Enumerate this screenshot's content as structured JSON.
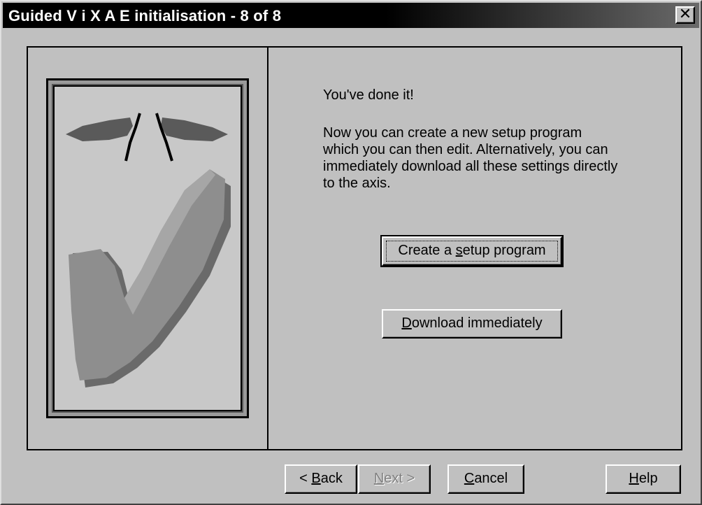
{
  "window": {
    "title": "Guided V i X A E initialisation - 8 of 8",
    "close_glyph": "✕"
  },
  "message": {
    "heading": "You've done it!",
    "body_lines": [
      "Now you can create a new setup program",
      "which you can then edit. Alternatively, you can",
      "immediately download all these settings directly",
      "to the axis."
    ]
  },
  "actions": {
    "create_setup": {
      "pre": "Create a ",
      "key": "s",
      "post": "etup program"
    },
    "download": {
      "pre": "",
      "key": "D",
      "post": "ownload immediately"
    }
  },
  "nav": {
    "back": {
      "pre": "< ",
      "key": "B",
      "post": "ack"
    },
    "next": {
      "pre": "",
      "key": "N",
      "post": "ext >",
      "enabled": false
    },
    "cancel": {
      "pre": "",
      "key": "C",
      "post": "ancel"
    },
    "help": {
      "pre": "",
      "key": "H",
      "post": "elp"
    }
  },
  "illustration": {
    "icon": "checkmark-icon",
    "colors": {
      "check": "#8e8e8e",
      "shadow": "#6a6a6a",
      "wings": "#5a5a5a"
    }
  }
}
